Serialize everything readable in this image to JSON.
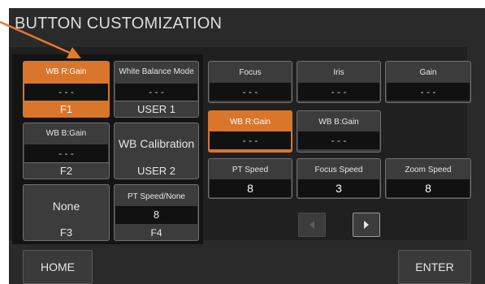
{
  "title": "BUTTON CUSTOMIZATION",
  "colors": {
    "accent": "#d9762b",
    "background": "#2a2a2a",
    "button": "#3c3c3c",
    "value_box": "#111111"
  },
  "assign_buttons": {
    "f1": {
      "label": "WB R:Gain",
      "value": "- - -",
      "key": "F1"
    },
    "user1": {
      "label": "White Balance Mode",
      "value": "- - -",
      "key": "USER 1"
    },
    "f2": {
      "label": "WB B:Gain",
      "value": "- - -",
      "key": "F2"
    },
    "user2": {
      "label": "WB Calibration",
      "key": "USER 2"
    },
    "f3": {
      "label": "None",
      "key": "F3"
    },
    "f4": {
      "label": "PT Speed/None",
      "value": "8",
      "key": "F4"
    }
  },
  "functions": {
    "focus": {
      "label": "Focus",
      "value": "- - -"
    },
    "iris": {
      "label": "Iris",
      "value": "- - -"
    },
    "gain": {
      "label": "Gain",
      "value": "- - -"
    },
    "wb_r_gain": {
      "label": "WB R:Gain",
      "value": "- - -"
    },
    "wb_b_gain": {
      "label": "WB B:Gain",
      "value": "- - -"
    },
    "pt_speed": {
      "label": "PT Speed",
      "value": "8"
    },
    "focus_speed": {
      "label": "Focus Speed",
      "value": "3"
    },
    "zoom_speed": {
      "label": "Zoom Speed",
      "value": "8"
    }
  },
  "pager": {
    "prev_icon": "triangle-left-icon",
    "next_icon": "triangle-right-icon"
  },
  "footer": {
    "home_label": "HOME",
    "enter_label": "ENTER"
  },
  "annotation": {
    "icon": "orange-arrow-icon"
  }
}
